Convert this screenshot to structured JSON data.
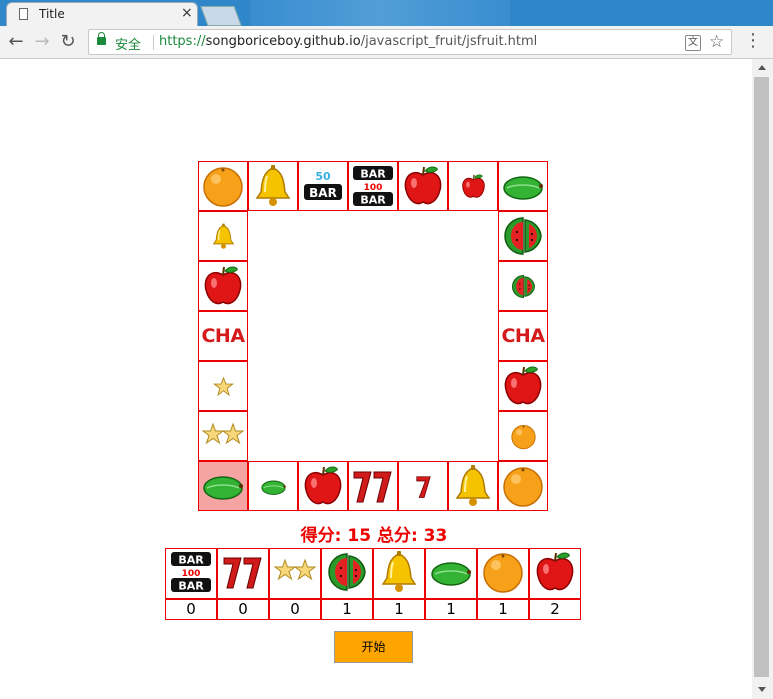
{
  "browser": {
    "tab_title": "Title",
    "secure_label": "安全",
    "url_scheme": "https://",
    "url_host": "songboriceboy.github.io",
    "url_path": "/javascript_fruit/jsfruit.html"
  },
  "board": {
    "cells": [
      {
        "fruit": "orange",
        "big": true
      },
      {
        "fruit": "bell",
        "big": true
      },
      {
        "fruit": "bar50",
        "big": true
      },
      {
        "fruit": "bar100",
        "big": true
      },
      {
        "fruit": "apple",
        "big": true
      },
      {
        "fruit": "apple",
        "big": false
      },
      {
        "fruit": "melon",
        "big": true
      },
      {
        "fruit": "watermelon",
        "big": true
      },
      {
        "fruit": "watermelon",
        "big": false
      },
      {
        "fruit": "cha",
        "label": "CHA"
      },
      {
        "fruit": "apple",
        "big": true
      },
      {
        "fruit": "orange",
        "big": false
      },
      {
        "fruit": "orange",
        "big": true
      },
      {
        "fruit": "bell",
        "big": true
      },
      {
        "fruit": "seven",
        "big": false
      },
      {
        "fruit": "seven",
        "big": true
      },
      {
        "fruit": "apple",
        "big": true
      },
      {
        "fruit": "melon",
        "big": false
      },
      {
        "fruit": "melon",
        "big": true,
        "active": true
      },
      {
        "fruit": "star",
        "big": true
      },
      {
        "fruit": "star",
        "big": false
      },
      {
        "fruit": "cha",
        "label": "CHA"
      },
      {
        "fruit": "apple",
        "big": true
      },
      {
        "fruit": "bell",
        "big": false
      }
    ],
    "active_index": 18,
    "colors": {
      "border": "#e00000",
      "active": "#f5a3a3"
    }
  },
  "score": {
    "text": "得分: 15 总分: 33"
  },
  "bets": [
    {
      "fruit": "bar100",
      "count": "0"
    },
    {
      "fruit": "seven",
      "count": "0"
    },
    {
      "fruit": "star",
      "count": "0"
    },
    {
      "fruit": "watermelon",
      "count": "1"
    },
    {
      "fruit": "bell",
      "count": "1"
    },
    {
      "fruit": "melon",
      "count": "1"
    },
    {
      "fruit": "orange",
      "count": "1"
    },
    {
      "fruit": "apple",
      "count": "2"
    }
  ],
  "start_button": {
    "label": "开始",
    "color": "#ffa500"
  }
}
